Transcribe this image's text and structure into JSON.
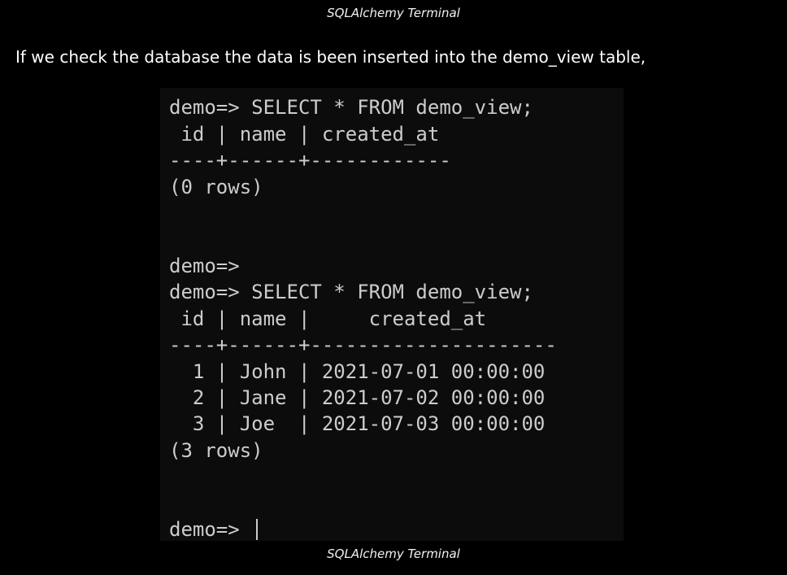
{
  "captions": {
    "top": "SQLAlchemy Terminal",
    "bottom": "SQLAlchemy Terminal"
  },
  "body_text": "If we check the database the data is been inserted into the demo_view table,",
  "terminal": {
    "lines": [
      "demo=> SELECT * FROM demo_view;",
      " id | name | created_at",
      "----+------+------------",
      "(0 rows)",
      "",
      "",
      "demo=>",
      "demo=> SELECT * FROM demo_view;",
      " id | name |     created_at",
      "----+------+---------------------",
      "  1 | John | 2021-07-01 00:00:00",
      "  2 | Jane | 2021-07-02 00:00:00",
      "  3 | Joe  | 2021-07-03 00:00:00",
      "(3 rows)",
      "",
      "",
      "",
      "demo=> "
    ],
    "colors": {
      "background": "#0c0c0c",
      "foreground": "#cccccc"
    }
  }
}
